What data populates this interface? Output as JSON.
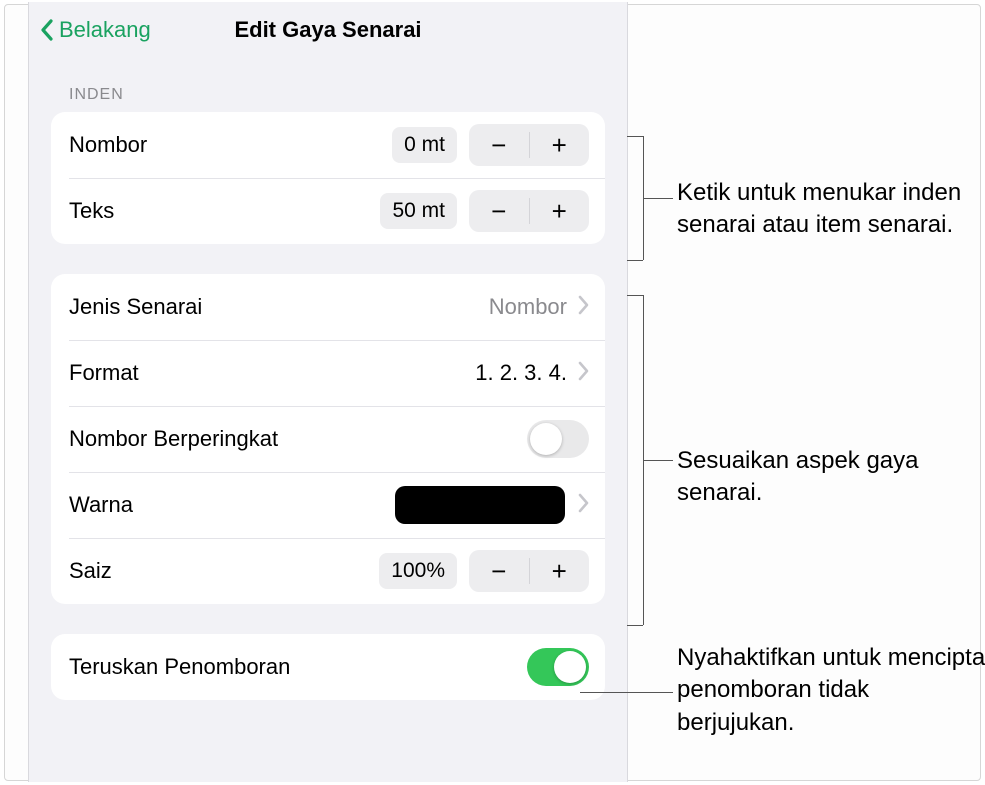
{
  "header": {
    "back_label": "Belakang",
    "title": "Edit Gaya Senarai"
  },
  "sections": {
    "indent_header": "INDEN"
  },
  "indent": {
    "number_label": "Nombor",
    "number_value": "0 mt",
    "text_label": "Teks",
    "text_value": "50 mt"
  },
  "style": {
    "list_type_label": "Jenis Senarai",
    "list_type_value": "Nombor",
    "format_label": "Format",
    "format_value": "1. 2. 3. 4.",
    "ranked_number_label": "Nombor Berperingkat",
    "ranked_number_on": false,
    "color_label": "Warna",
    "color_value": "#000000",
    "size_label": "Saiz",
    "size_value": "100%"
  },
  "continue_numbering": {
    "label": "Teruskan Penomboran",
    "on": true
  },
  "steppers": {
    "minus": "−",
    "plus": "+"
  },
  "callouts": {
    "indent": "Ketik untuk menukar inden senarai atau item senarai.",
    "style": "Sesuaikan aspek gaya senarai.",
    "continue": "Nyahaktifkan untuk mencipta penomboran tidak berjujukan."
  }
}
